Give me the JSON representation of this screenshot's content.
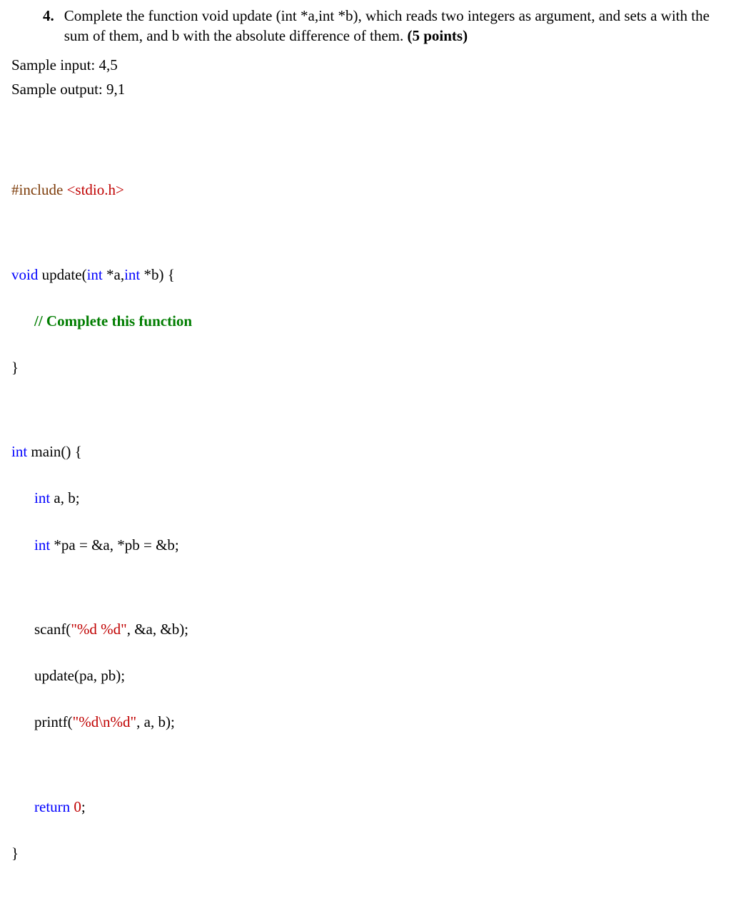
{
  "question": {
    "number": "4.",
    "text_part1": "Complete the function void update (int *a,int *b), which reads two integers as argument, and sets a with the sum of them, and b with the absolute difference of them. ",
    "points": "(5 points)"
  },
  "samples": {
    "input_label": "Sample input: 4,5",
    "output_label": "Sample output: 9,1"
  },
  "code": {
    "include_directive": "#include",
    "include_header": " <stdio.h>",
    "kw_void": "void",
    "fn_update_sig": " update(",
    "kw_int": "int",
    "ptr_a": " *a,",
    "ptr_b": " *b) {",
    "comment": "// Complete this function",
    "close_brace": "}",
    "main_sig": " main() {",
    "decl_ab": " a, b;",
    "decl_ptrs": " *pa = &a, *pb = &b;",
    "scanf_call_pre": "scanf(",
    "scanf_fmt": "\"%d %d\"",
    "scanf_args": ", &a, &b);",
    "update_call": "update(pa, pb);",
    "printf_call_pre": "printf(",
    "printf_fmt": "\"%d\\n%d\"",
    "printf_args": ", a, b);",
    "return_kw": "return",
    "return_sp": " ",
    "return_zero": "0",
    "return_semi": ";"
  }
}
